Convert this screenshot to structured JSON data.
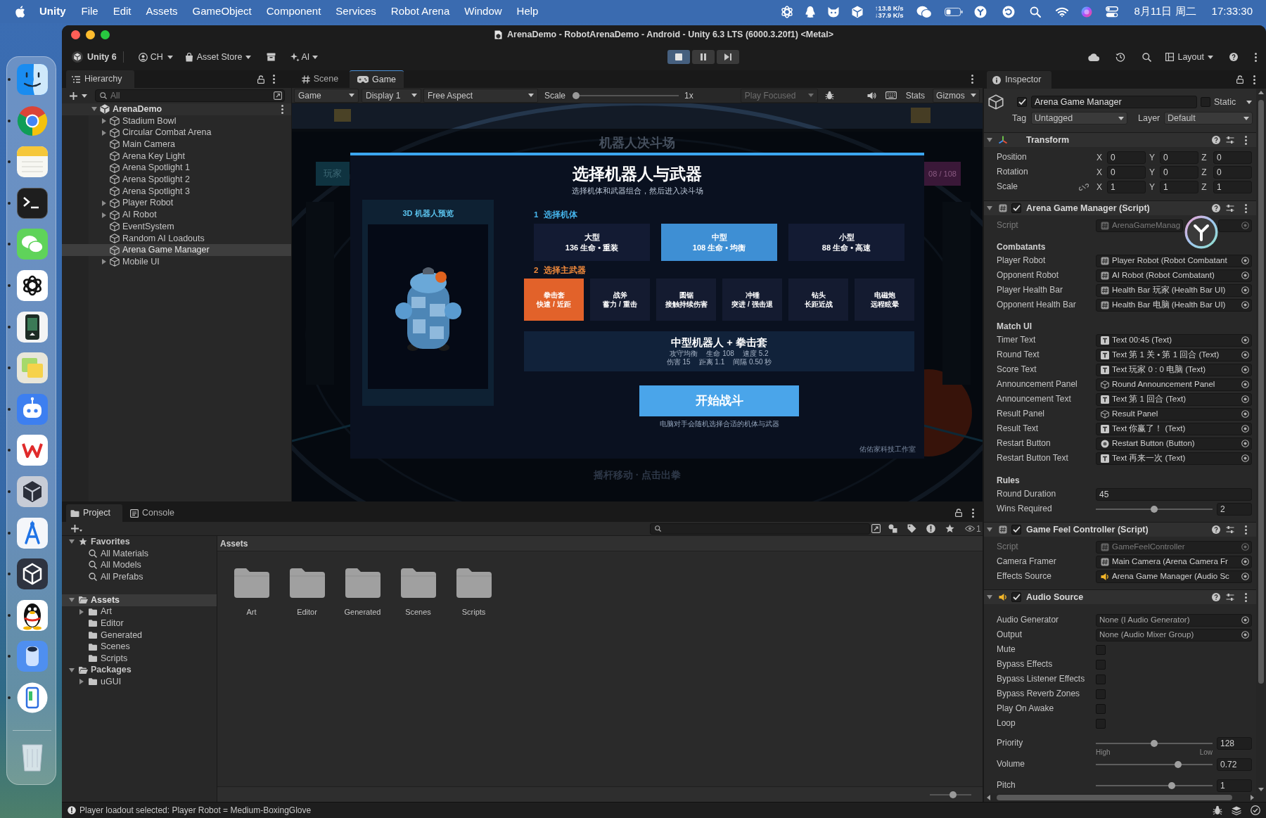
{
  "menu_bar": {
    "app_name": "Unity",
    "menus": [
      "File",
      "Edit",
      "Assets",
      "GameObject",
      "Component",
      "Services",
      "Robot Arena",
      "Window",
      "Help"
    ],
    "network": {
      "upload": "↑13.8 K/s",
      "download": "↓37.9 K/s"
    },
    "date": "8月11日 周二",
    "time": "17:33:30"
  },
  "dock": {
    "items": [
      {
        "kind": "finder",
        "running": true
      },
      {
        "kind": "browser",
        "running": true
      },
      {
        "kind": "notes",
        "running": true
      },
      {
        "kind": "terminal",
        "running": true
      },
      {
        "kind": "messenger",
        "running": true
      },
      {
        "kind": "assistant",
        "running": true
      },
      {
        "kind": "reader",
        "running": true
      },
      {
        "kind": "stickies",
        "running": true
      },
      {
        "kind": "bot",
        "running": true
      },
      {
        "kind": "office",
        "running": true
      },
      {
        "kind": "unity",
        "running": true
      },
      {
        "kind": "designer",
        "running": true
      },
      {
        "kind": "hub",
        "running": true
      },
      {
        "kind": "penguin",
        "running": true
      },
      {
        "kind": "device",
        "running": true
      },
      {
        "kind": "phone",
        "running": true
      },
      {
        "kind": "trash"
      }
    ]
  },
  "window": {
    "title": "ArenaDemo - RobotArenaDemo - Android - Unity 6.3 LTS (6000.3.20f1) <Metal>"
  },
  "toolbar": {
    "version": "Unity 6",
    "account": "CH",
    "asset_store": "Asset Store",
    "ai": "AI",
    "playing": true,
    "paused": false,
    "layout": "Layout"
  },
  "hierarchy": {
    "title": "Hierarchy",
    "search_placeholder": "All",
    "scene": {
      "label": "ArenaDemo",
      "expanded": true,
      "selected": false,
      "children": [
        {
          "label": "Stadium Bowl",
          "expanded": false,
          "selected": false
        },
        {
          "label": "Circular Combat Arena",
          "expanded": false,
          "selected": false
        },
        {
          "label": "Main Camera",
          "selected": false
        },
        {
          "label": "Arena Key Light",
          "selected": false
        },
        {
          "label": "Arena Spotlight 1",
          "selected": false
        },
        {
          "label": "Arena Spotlight 2",
          "selected": false
        },
        {
          "label": "Arena Spotlight 3",
          "selected": false
        },
        {
          "label": "Player Robot",
          "expanded": false,
          "selected": false
        },
        {
          "label": "AI Robot",
          "expanded": false,
          "selected": false
        },
        {
          "label": "EventSystem",
          "selected": false
        },
        {
          "label": "Random AI Loadouts",
          "selected": false
        },
        {
          "label": "Arena Game Manager",
          "selected": true
        },
        {
          "label": "Mobile UI",
          "expanded": false,
          "selected": false
        }
      ]
    }
  },
  "game_panel": {
    "tabs": [
      {
        "kind": "scene",
        "label": "Scene",
        "selected": false
      },
      {
        "kind": "game",
        "label": "Game",
        "selected": true
      }
    ],
    "controls": {
      "view": "Game",
      "display": "Display 1",
      "aspect": "Free Aspect",
      "scale_label": "Scale",
      "scale": {
        "level": 0
      },
      "scale_value": "1x",
      "play_mode": "Play Focused",
      "stats": "Stats",
      "gizmos": "Gizmos"
    },
    "hud": {
      "title": "机器人决斗场",
      "player_tag": "玩家",
      "health": "08 / 108",
      "hint": "摇杆移动 · 点击出拳"
    },
    "dialog": {
      "title": "选择机器人与武器",
      "subtitle": "选择机体和武器组合，然后进入决斗场",
      "preview_label": "3D 机器人预览",
      "body_step": {
        "number": "1",
        "label": "选择机体"
      },
      "bodies": [
        {
          "name": "大型",
          "stats": "136 生命 • 重装",
          "selected": false
        },
        {
          "name": "中型",
          "stats": "108 生命 • 均衡",
          "selected": true
        },
        {
          "name": "小型",
          "stats": "88 生命 • 高速",
          "selected": false
        }
      ],
      "weapon_step": {
        "number": "2",
        "label": "选择主武器"
      },
      "weapons": [
        {
          "name": "拳击套",
          "traits": "快速 / 近距",
          "selected": true
        },
        {
          "name": "战斧",
          "traits": "蓄力 / 重击",
          "selected": false
        },
        {
          "name": "圆锯",
          "traits": "接触持续伤害",
          "selected": false
        },
        {
          "name": "冲锤",
          "traits": "突进 / 强击退",
          "selected": false
        },
        {
          "name": "钻头",
          "traits": "长距近战",
          "selected": false
        },
        {
          "name": "电磁炮",
          "traits": "远程眩晕",
          "selected": false
        }
      ],
      "summary": {
        "title": "中型机器人 + 拳击套",
        "stat_lines": [
          [
            "攻守均衡",
            "生命 108",
            "速度 5.2"
          ],
          [
            "伤害 15",
            "距离 1.1",
            "间隔 0.50 秒"
          ]
        ]
      },
      "start_button": "开始战斗",
      "hint": "电脑对手会随机选择合适的机体与武器",
      "credit": "佑佑家科技工作室"
    }
  },
  "inspector": {
    "title": "Inspector",
    "object": {
      "active": true,
      "name": "Arena Game Manager",
      "static": false,
      "static_label": "Static",
      "tag_label": "Tag",
      "tag": "Untagged",
      "layer_label": "Layer",
      "layer": "Default"
    },
    "components": [
      {
        "kind": "transform",
        "title": "Transform",
        "expanded": true,
        "rows": [
          {
            "label": "Position",
            "axes": [
              {
                "axis": "X",
                "value": "0"
              },
              {
                "axis": "Y",
                "value": "0"
              },
              {
                "axis": "Z",
                "value": "0"
              }
            ]
          },
          {
            "label": "Rotation",
            "axes": [
              {
                "axis": "X",
                "value": "0"
              },
              {
                "axis": "Y",
                "value": "0"
              },
              {
                "axis": "Z",
                "value": "0"
              }
            ]
          },
          {
            "label": "Scale",
            "proportional": false,
            "axes": [
              {
                "axis": "X",
                "value": "1"
              },
              {
                "axis": "Y",
                "value": "1"
              },
              {
                "axis": "Z",
                "value": "1"
              }
            ]
          }
        ]
      },
      {
        "kind": "script",
        "title": "Arena Game Manager (Script)",
        "enabled": true,
        "expanded": true,
        "script": {
          "label": "Script",
          "value": "ArenaGameManag",
          "disabled": true
        },
        "groups": [
          {
            "header": "Combatants",
            "fields": [
              {
                "kind": "script_ref",
                "label": "Player Robot",
                "value": "Player Robot (Robot Combatant"
              },
              {
                "kind": "script_ref",
                "label": "Opponent Robot",
                "value": "AI Robot (Robot Combatant)"
              },
              {
                "kind": "script_ref",
                "label": "Player Health Bar",
                "value": "Health Bar 玩家 (Health Bar UI)"
              },
              {
                "kind": "script_ref",
                "label": "Opponent Health Bar",
                "value": "Health Bar 电脑 (Health Bar UI)"
              }
            ]
          },
          {
            "header": "Match UI",
            "fields": [
              {
                "kind": "text_ref",
                "label": "Timer Text",
                "value": "Text 00:45 (Text)"
              },
              {
                "kind": "text_ref",
                "label": "Round Text",
                "value": "Text 第 1 关 • 第 1 回合 (Text)"
              },
              {
                "kind": "text_ref",
                "label": "Score Text",
                "value": "Text 玩家 0 : 0 电脑 (Text)"
              },
              {
                "kind": "object_ref",
                "label": "Announcement Panel",
                "value": "Round Announcement Panel"
              },
              {
                "kind": "text_ref",
                "label": "Announcement Text",
                "value": "Text 第 1 回合 (Text)"
              },
              {
                "kind": "object_ref",
                "label": "Result Panel",
                "value": "Result Panel"
              },
              {
                "kind": "text_ref",
                "label": "Result Text",
                "value": "Text 你赢了！ (Text)"
              },
              {
                "kind": "button_ref",
                "label": "Restart Button",
                "value": "Restart Button (Button)"
              },
              {
                "kind": "text_ref",
                "label": "Restart Button Text",
                "value": "Text 再来一次 (Text)"
              }
            ]
          },
          {
            "header": "Rules",
            "fields": [
              {
                "kind": "number",
                "label": "Round Duration",
                "value": "45"
              },
              {
                "kind": "slider",
                "label": "Wins Required",
                "level": 0.5,
                "value": "2"
              }
            ]
          }
        ]
      },
      {
        "kind": "script",
        "title": "Game Feel Controller (Script)",
        "enabled": true,
        "expanded": true,
        "script": {
          "label": "Script",
          "value": "GameFeelController",
          "disabled": true
        },
        "groups": [
          {
            "fields": [
              {
                "kind": "script_ref",
                "label": "Camera Framer",
                "value": "Main Camera (Arena Camera Fr"
              },
              {
                "kind": "audio_ref",
                "label": "Effects Source",
                "value": "Arena Game Manager (Audio Sc"
              }
            ]
          }
        ]
      },
      {
        "kind": "audio",
        "title": "Audio Source",
        "enabled": true,
        "expanded": true,
        "groups": [
          {
            "fields": [
              {
                "kind": "empty_ref",
                "label": "Audio Generator",
                "value": "None (I Audio Generator)"
              },
              {
                "kind": "empty_ref",
                "label": "Output",
                "value": "None (Audio Mixer Group)"
              },
              {
                "kind": "checkbox",
                "label": "Mute",
                "checked": false
              },
              {
                "kind": "checkbox",
                "label": "Bypass Effects",
                "checked": false
              },
              {
                "kind": "checkbox",
                "label": "Bypass Listener Effects",
                "checked": false
              },
              {
                "kind": "checkbox",
                "label": "Bypass Reverb Zones",
                "checked": false
              },
              {
                "kind": "checkbox",
                "label": "Play On Awake",
                "checked": false
              },
              {
                "kind": "checkbox",
                "label": "Loop",
                "checked": false
              },
              {
                "kind": "slider",
                "label": "Priority",
                "level": 0.5,
                "value": "128",
                "min_label": "High",
                "max_label": "Low"
              },
              {
                "kind": "slider",
                "label": "Volume",
                "level": 0.72,
                "value": "0.72"
              },
              {
                "kind": "slider",
                "label": "Pitch",
                "level": 0.66,
                "value": "1"
              }
            ]
          }
        ]
      }
    ]
  },
  "project": {
    "tabs": [
      {
        "kind": "project",
        "label": "Project",
        "selected": true
      },
      {
        "kind": "console",
        "label": "Console",
        "selected": false
      }
    ],
    "hidden_count": "1",
    "favorites": {
      "label": "Favorites",
      "expanded": true,
      "items": [
        {
          "label": "All Materials",
          "selected": false
        },
        {
          "label": "All Models",
          "selected": false
        },
        {
          "label": "All Prefabs",
          "selected": false
        }
      ]
    },
    "roots": [
      {
        "label": "Assets",
        "expanded": true,
        "selected": true,
        "children": [
          {
            "label": "Art",
            "expanded": false,
            "selected": false
          },
          {
            "label": "Editor",
            "selected": false
          },
          {
            "label": "Generated",
            "selected": false
          },
          {
            "label": "Scenes",
            "selected": false
          },
          {
            "label": "Scripts",
            "selected": false
          }
        ]
      },
      {
        "label": "Packages",
        "expanded": true,
        "selected": false,
        "children": [
          {
            "label": "uGUI",
            "expanded": false,
            "selected": false
          }
        ]
      }
    ],
    "breadcrumb": "Assets",
    "folders": [
      {
        "name": "Art",
        "selected": false
      },
      {
        "name": "Editor",
        "selected": false
      },
      {
        "name": "Generated",
        "selected": false
      },
      {
        "name": "Scenes",
        "selected": false
      },
      {
        "name": "Scripts",
        "selected": false
      }
    ],
    "zoom": {
      "level": 0.58
    }
  },
  "status_bar": {
    "message": "Player loadout selected: Player Robot = Medium-BoxingGlove"
  }
}
